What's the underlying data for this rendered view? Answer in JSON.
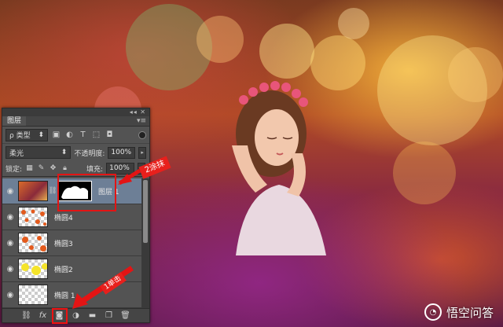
{
  "panel": {
    "tab": "图层",
    "menu_icon": "panel-menu-icon",
    "filter": {
      "label": "ρ 类型"
    },
    "blend_mode": "柔光",
    "opacity_label": "不透明度:",
    "opacity_value": "100%",
    "lock_label": "锁定:",
    "fill_label": "填充:",
    "fill_value": "100%",
    "layers": [
      {
        "name": "图层 1",
        "visible": true,
        "active": true
      },
      {
        "name": "椭圆4",
        "visible": true
      },
      {
        "name": "椭圆3",
        "visible": true
      },
      {
        "name": "椭圆2",
        "visible": true
      },
      {
        "name": "椭圆 1",
        "visible": true
      }
    ],
    "footer_icons": [
      "link-icon",
      "fx-icon",
      "add-mask-icon",
      "adjustment-icon",
      "folder-icon",
      "new-layer-icon",
      "trash-icon"
    ]
  },
  "annotations": {
    "step2": "2涂抹",
    "step1": "1单击"
  },
  "watermark": "悟空问答",
  "colors": {
    "annotation_red": "#e31414",
    "panel_bg": "#535353",
    "active_layer": "#6d7f96"
  }
}
